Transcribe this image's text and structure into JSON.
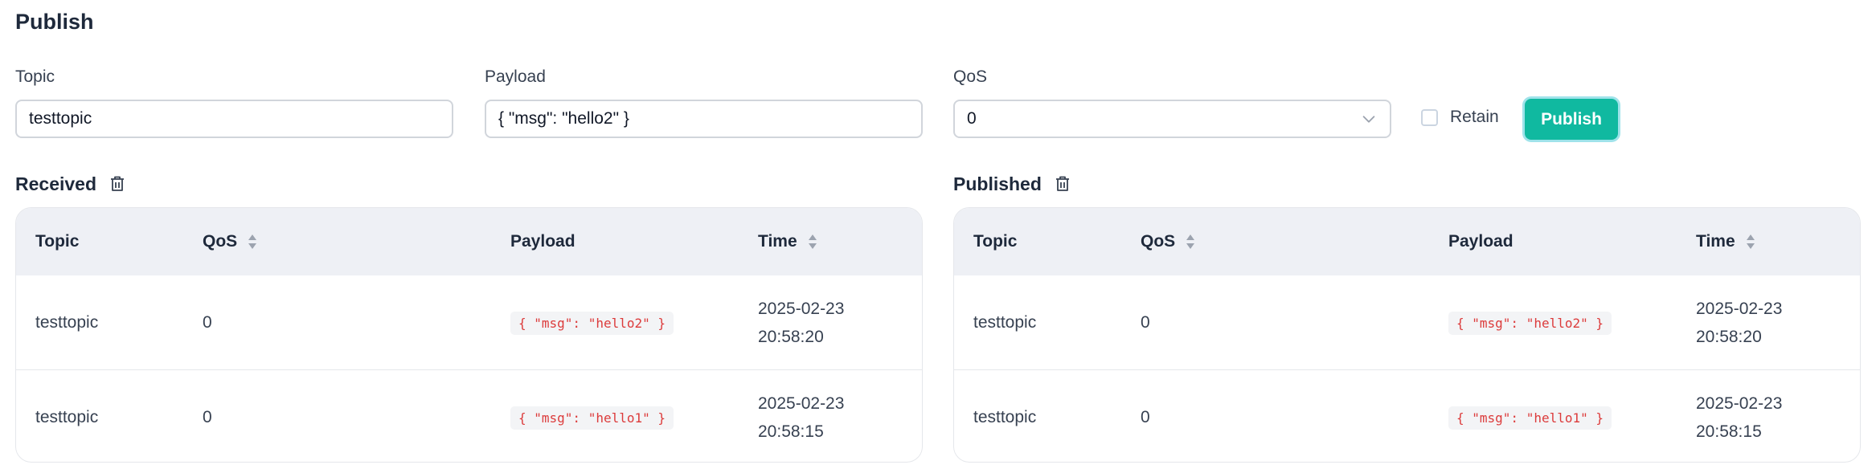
{
  "publish": {
    "title": "Publish",
    "topic_label": "Topic",
    "topic_value": "testtopic",
    "payload_label": "Payload",
    "payload_value": "{ \"msg\": \"hello2\" }",
    "qos_label": "QoS",
    "qos_value": "0",
    "retain_label": "Retain",
    "retain_checked": false,
    "publish_button": "Publish"
  },
  "received": {
    "title": "Received",
    "columns": {
      "topic": "Topic",
      "qos": "QoS",
      "payload": "Payload",
      "time": "Time"
    },
    "rows": [
      {
        "topic": "testtopic",
        "qos": "0",
        "payload": "{ \"msg\": \"hello2\" }",
        "date": "2025-02-23",
        "time": "20:58:20"
      },
      {
        "topic": "testtopic",
        "qos": "0",
        "payload": "{ \"msg\": \"hello1\" }",
        "date": "2025-02-23",
        "time": "20:58:15"
      }
    ]
  },
  "published": {
    "title": "Published",
    "columns": {
      "topic": "Topic",
      "qos": "QoS",
      "payload": "Payload",
      "time": "Time"
    },
    "rows": [
      {
        "topic": "testtopic",
        "qos": "0",
        "payload": "{ \"msg\": \"hello2\" }",
        "date": "2025-02-23",
        "time": "20:58:20"
      },
      {
        "topic": "testtopic",
        "qos": "0",
        "payload": "{ \"msg\": \"hello1\" }",
        "date": "2025-02-23",
        "time": "20:58:15"
      }
    ]
  },
  "colors": {
    "accent": "#10b9a0",
    "payload_code": "#dc3b3b",
    "header_bg": "#eef0f5"
  },
  "icons": [
    "chevron-down-icon",
    "trash-icon",
    "sort-icon"
  ]
}
